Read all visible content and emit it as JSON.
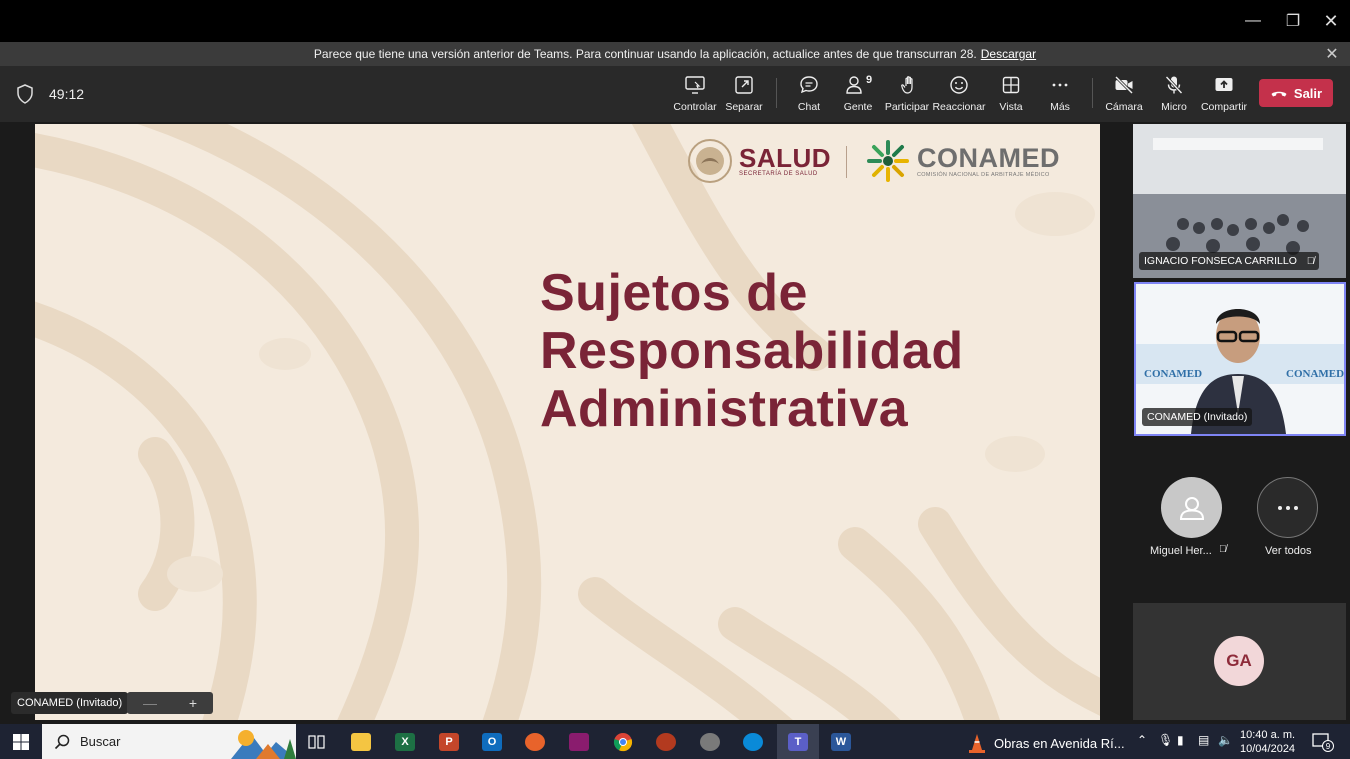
{
  "banner": {
    "message": "Parece que tiene una versión anterior de Teams. Para continuar usando la aplicación, actualice antes de que transcurran 28.",
    "link": "Descargar"
  },
  "meeting": {
    "timer": "49:12"
  },
  "toolbar": {
    "controlar": "Controlar",
    "separar": "Separar",
    "chat": "Chat",
    "gente": "Gente",
    "gente_count": "9",
    "participar": "Participar",
    "reaccionar": "Reaccionar",
    "vista": "Vista",
    "mas": "Más",
    "camara": "Cámara",
    "micro": "Micro",
    "compartir": "Compartir",
    "salir": "Salir"
  },
  "slide": {
    "title_line1": "Sujetos de",
    "title_line2": "Responsabilidad",
    "title_line3": "Administrativa",
    "logo1_name": "SALUD",
    "logo1_sub": "SECRETARÍA DE SALUD",
    "logo2_name": "CONAMED",
    "logo2_sub": "COMISIÓN NACIONAL DE ARBITRAJE MÉDICO"
  },
  "presenter": {
    "label": "CONAMED (Invitado)"
  },
  "participants": {
    "tile1_name": "IGNACIO FONSECA CARRILLO",
    "tile2_name": "CONAMED (Invitado)",
    "tile2_wall_text": "CONAMED",
    "person3_name": "Miguel Her...",
    "see_all": "Ver todos",
    "ga_initials": "GA"
  },
  "taskbar": {
    "search_placeholder": "Buscar",
    "news": "Obras en Avenida Rí...",
    "time": "10:40 a. m.",
    "date": "10/04/2024",
    "notif_count": "9"
  },
  "colors": {
    "slide_title": "#7a2437",
    "leave_button": "#c4314b",
    "active_border": "#7f85f5"
  }
}
